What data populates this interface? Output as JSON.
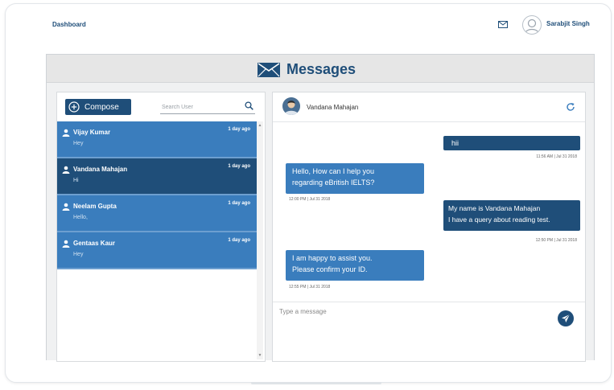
{
  "topbar": {
    "dashboard_label": "Dashboard",
    "user_name": "Sarabjit Singh"
  },
  "page": {
    "title": "Messages"
  },
  "sidebar": {
    "compose_label": "Compose",
    "search_placeholder": "Search User",
    "contacts": [
      {
        "name": "Vijay Kumar",
        "preview": "Hey",
        "time": "1 day ago",
        "active": false
      },
      {
        "name": "Vandana Mahajan",
        "preview": "Hi",
        "time": "1 day ago",
        "active": true
      },
      {
        "name": "Neelam Gupta",
        "preview": "Hello,",
        "time": "1 day ago",
        "active": false
      },
      {
        "name": "Gentaas Kaur",
        "preview": "Hey",
        "time": "1 day ago",
        "active": false
      }
    ]
  },
  "chat": {
    "contact_name": "Vandana Mahajan",
    "messages": [
      {
        "direction": "out",
        "lines": [
          "hii"
        ],
        "time": "11:56 AM | Jul 31 2018"
      },
      {
        "direction": "in",
        "lines": [
          "Hello, How can I help you",
          "regarding eBritish IELTS?"
        ],
        "time": "12:00 PM | Jul 31 2018"
      },
      {
        "direction": "out",
        "lines": [
          "My name is Vandana Mahajan",
          "I have a query about reading test."
        ],
        "time": "12:50 PM | Jul 31 2018"
      },
      {
        "direction": "in",
        "lines": [
          "I am happy to assist you.",
          "Please confirm your ID."
        ],
        "time": "12:55 PM | Jul 31 2018"
      }
    ],
    "input_placeholder": "Type a message"
  },
  "colors": {
    "primary": "#1f4e79",
    "secondary": "#3a7dbd",
    "frame": "#f0f1f2"
  },
  "icons": {
    "mail": "mail-icon",
    "compose": "plus-circle-icon",
    "search": "search-icon",
    "refresh": "refresh-icon",
    "send": "send-icon",
    "person": "person-icon"
  }
}
